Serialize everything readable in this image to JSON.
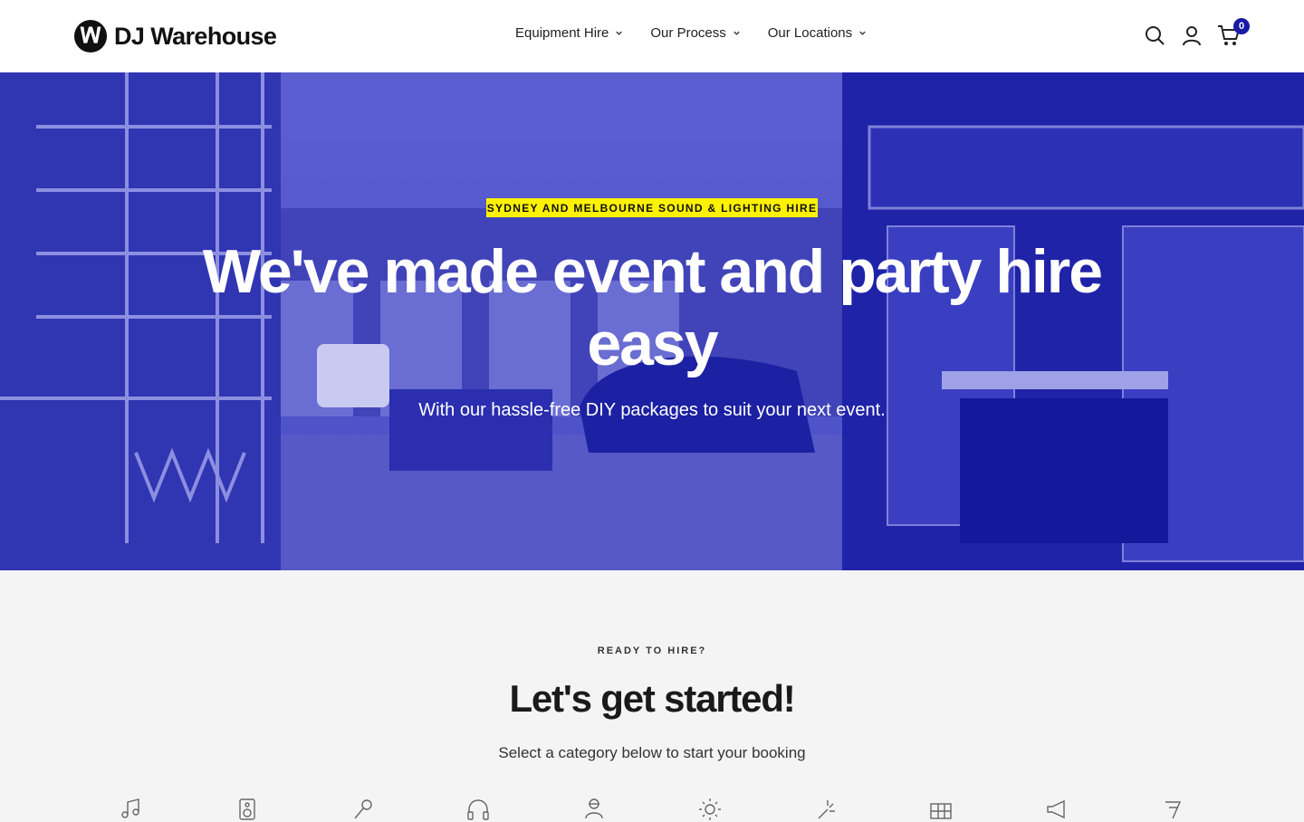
{
  "header": {
    "logo_text": "DJ Warehouse",
    "nav": [
      {
        "label": "Equipment Hire"
      },
      {
        "label": "Our Process"
      },
      {
        "label": "Our Locations"
      }
    ],
    "icons": [
      "search-icon",
      "account-icon",
      "cart-icon"
    ],
    "cart_count": "0"
  },
  "hero": {
    "eyebrow": "SYDNEY AND MELBOURNE SOUND & LIGHTING HIRE",
    "title": "We've made event and party hire easy",
    "subtitle": "With our hassle-free DIY packages to suit your next event.",
    "colors": {
      "overlay": "#2b2fc4",
      "eyebrow_bg": "#fff200"
    }
  },
  "intro": {
    "kicker": "READY TO HIRE?",
    "title": "Let's get started!",
    "subtitle": "Select a category below to start your booking",
    "category_icons": [
      "music-note-icon",
      "speaker-icon",
      "microphone-icon",
      "headphones-icon",
      "dj-icon",
      "light-icon",
      "effects-icon",
      "staging-icon",
      "megaphone-icon",
      "cable-icon"
    ]
  },
  "colors": {
    "accent": "#1a1aa8",
    "text": "#1a1a1a",
    "bg": "#f4f4f5"
  }
}
